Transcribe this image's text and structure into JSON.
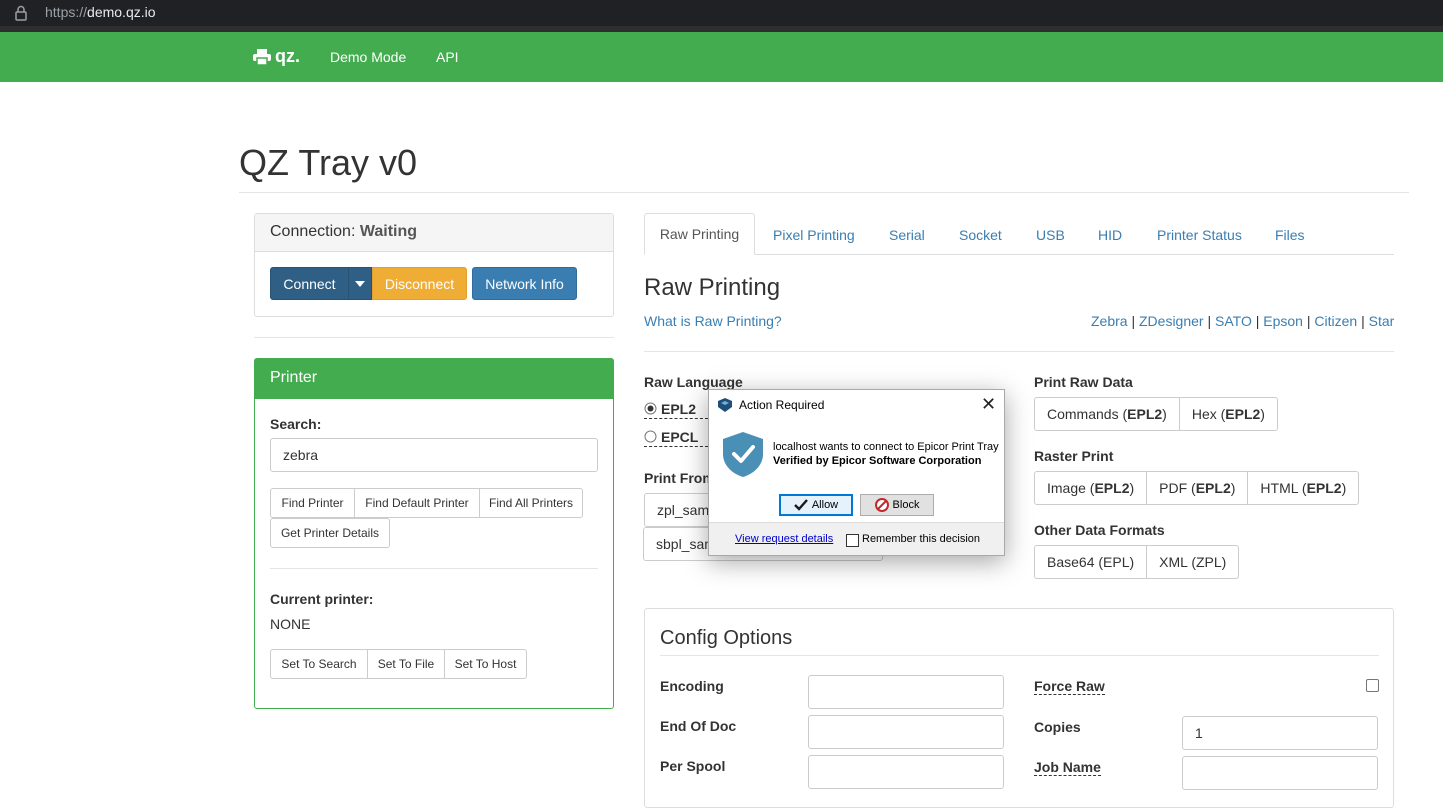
{
  "browser": {
    "url_scheme": "https://",
    "url_host": "demo.qz.io"
  },
  "navbar": {
    "brand": "qz.",
    "links": [
      "Demo Mode",
      "API"
    ]
  },
  "page": {
    "title": "QZ Tray v0"
  },
  "connection": {
    "label": "Connection:",
    "status": "Waiting",
    "connect_label": "Connect",
    "disconnect_label": "Disconnect",
    "network_info_label": "Network Info"
  },
  "printer": {
    "heading": "Printer",
    "search_label": "Search:",
    "search_value": "zebra",
    "find_printer": "Find Printer",
    "find_default": "Find Default Printer",
    "find_all": "Find All Printers",
    "get_details": "Get Printer Details",
    "current_label": "Current printer:",
    "current_value": "NONE",
    "set_to_search": "Set To Search",
    "set_to_file": "Set To File",
    "set_to_host": "Set To Host"
  },
  "tabs": [
    "Raw Printing",
    "Pixel Printing",
    "Serial",
    "Socket",
    "USB",
    "HID",
    "Printer Status",
    "Files"
  ],
  "raw": {
    "heading": "Raw Printing",
    "what_is": "What is Raw Printing?",
    "brands": [
      "Zebra",
      "ZDesigner",
      "SATO",
      "Epson",
      "Citizen",
      "Star"
    ],
    "separator": "|",
    "raw_language_label": "Raw Language",
    "lang_options": [
      "EPL2",
      "EPCL"
    ],
    "print_from_label": "Print From",
    "print_from_files": [
      "zpl_sam",
      "sbpl_sam"
    ],
    "print_raw_data_label": "Print Raw Data",
    "raw_data_buttons": [
      {
        "pre": "Commands (",
        "bold": "EPL2",
        "post": ")"
      },
      {
        "pre": "Hex (",
        "bold": "EPL2",
        "post": ")"
      }
    ],
    "raster_label": "Raster Print",
    "raster_buttons": [
      {
        "pre": "Image (",
        "bold": "EPL2",
        "post": ")"
      },
      {
        "pre": "PDF (",
        "bold": "EPL2",
        "post": ")"
      },
      {
        "pre": "HTML (",
        "bold": "EPL2",
        "post": ")"
      }
    ],
    "other_label": "Other Data Formats",
    "other_buttons": [
      "Base64 (EPL)",
      "XML (ZPL)"
    ]
  },
  "config": {
    "heading": "Config Options",
    "encoding_label": "Encoding",
    "end_of_doc_label": "End Of Doc",
    "per_spool_label": "Per Spool",
    "force_raw_label": "Force Raw",
    "copies_label": "Copies",
    "copies_value": "1",
    "job_name_label": "Job Name"
  },
  "dialog": {
    "title": "Action Required",
    "message": "localhost wants to connect to Epicor Print Tray",
    "verified": "Verified by Epicor Software Corporation",
    "allow": "Allow",
    "block": "Block",
    "view_details": "View request details",
    "remember": "Remember this decision"
  },
  "colors": {
    "navbar": "#43ac4f",
    "primary": "#2f5f85",
    "warning": "#f0ad36",
    "info": "#3a7eb1",
    "link": "#3a7eb1",
    "shield": "#4a8fb5"
  }
}
